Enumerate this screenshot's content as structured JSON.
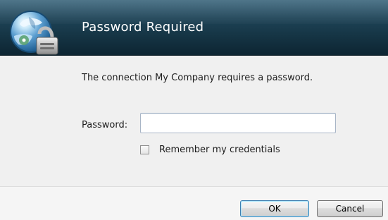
{
  "dialog": {
    "title": "Password Required",
    "message": "The connection My Company requires a password.",
    "password_label": "Password:",
    "password_value": "",
    "remember_label": "Remember my credentials",
    "remember_checked": false,
    "ok_label": "OK",
    "cancel_label": "Cancel",
    "icon": "globe-lock-icon"
  },
  "colors": {
    "header_top": "#2d5b73",
    "header_bottom": "#0d2532",
    "default_button_border": "#3c7fb1"
  }
}
